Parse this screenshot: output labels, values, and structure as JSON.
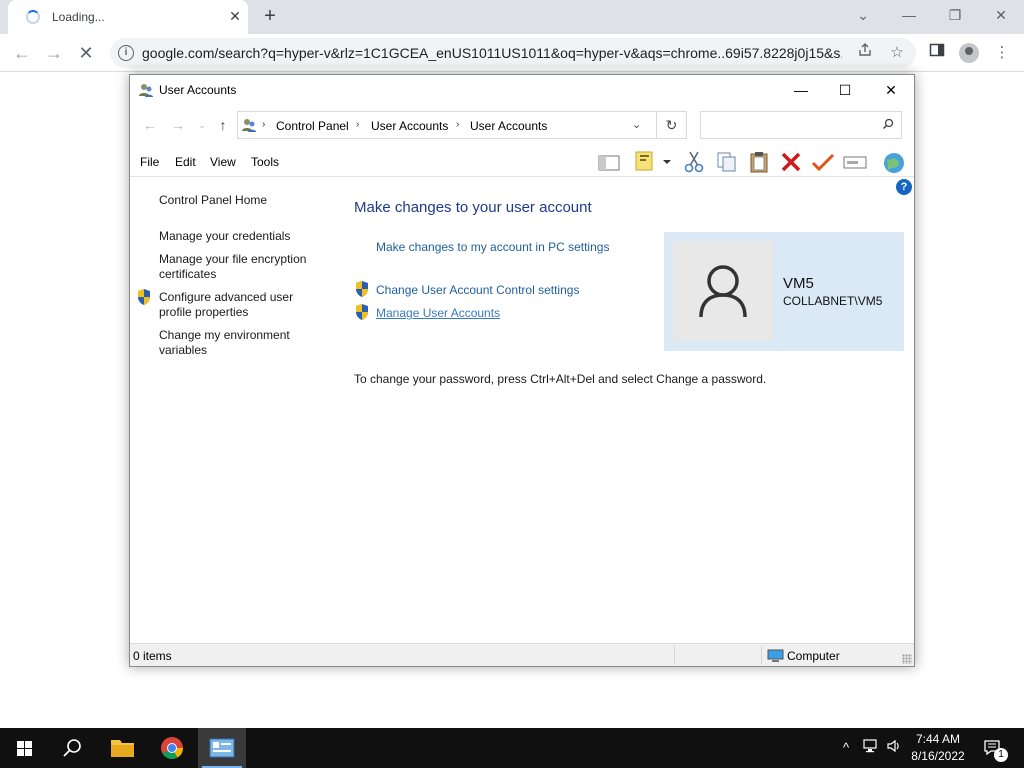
{
  "browser": {
    "tab_title": "Loading...",
    "tab_close": "✕",
    "new_tab": "+",
    "window_controls": {
      "chevron": "⌄",
      "minimize": "—",
      "restore": "❐",
      "close": "✕"
    },
    "nav": {
      "back": "←",
      "forward": "→",
      "stop": "✕"
    },
    "url": "google.com/search?q=hyper-v&rlz=1C1GCEA_enUS1011US1011&oq=hyper-v&aqs=chrome..69i57.8228j0j15&s...",
    "info_icon": "i",
    "menu": "⋮"
  },
  "window": {
    "title": "User Accounts",
    "controls": {
      "minimize": "—",
      "maximize": "☐",
      "close": "✕"
    },
    "address": {
      "back": "←",
      "forward": "→",
      "recent": "⌄",
      "up": "↑",
      "breadcrumbs": [
        "Control Panel",
        "User Accounts",
        "User Accounts"
      ],
      "separator": "›",
      "dropdown": "⌄",
      "refresh": "↻",
      "search_placeholder": "",
      "search_icon": "⚲"
    },
    "menu": [
      "File",
      "Edit",
      "View",
      "Tools"
    ],
    "toolbar_icons": [
      "pane-icon",
      "properties-icon",
      "dropdown-arrow-icon",
      "cut-icon",
      "copy-icon",
      "paste-icon",
      "delete-icon",
      "check-icon",
      "rename-icon",
      "globe-icon"
    ],
    "help": "?",
    "sidebar": {
      "home": "Control Panel Home",
      "links": [
        "Manage your credentials",
        "Manage your file encryption certificates",
        "Configure advanced user profile properties",
        "Change my environment variables"
      ]
    },
    "main": {
      "heading": "Make changes to your user account",
      "pc_settings_link": "Make changes to my account in PC settings",
      "uac_link": "Change User Account Control settings",
      "manage_link": "Manage User Accounts",
      "password_note": "To change your password, press Ctrl+Alt+Del and select Change a password."
    },
    "user": {
      "name": "VM5",
      "domain": "COLLABNET\\VM5"
    },
    "status": {
      "items": "0 items",
      "location": "Computer"
    }
  },
  "taskbar": {
    "time": "7:44 AM",
    "date": "8/16/2022",
    "notification_count": "1",
    "tray_chevron": "^"
  },
  "colors": {
    "link": "#1f5f9e",
    "heading": "#1e3a8a",
    "user_card": "#dbe9f7",
    "taskbar": "#101010"
  }
}
